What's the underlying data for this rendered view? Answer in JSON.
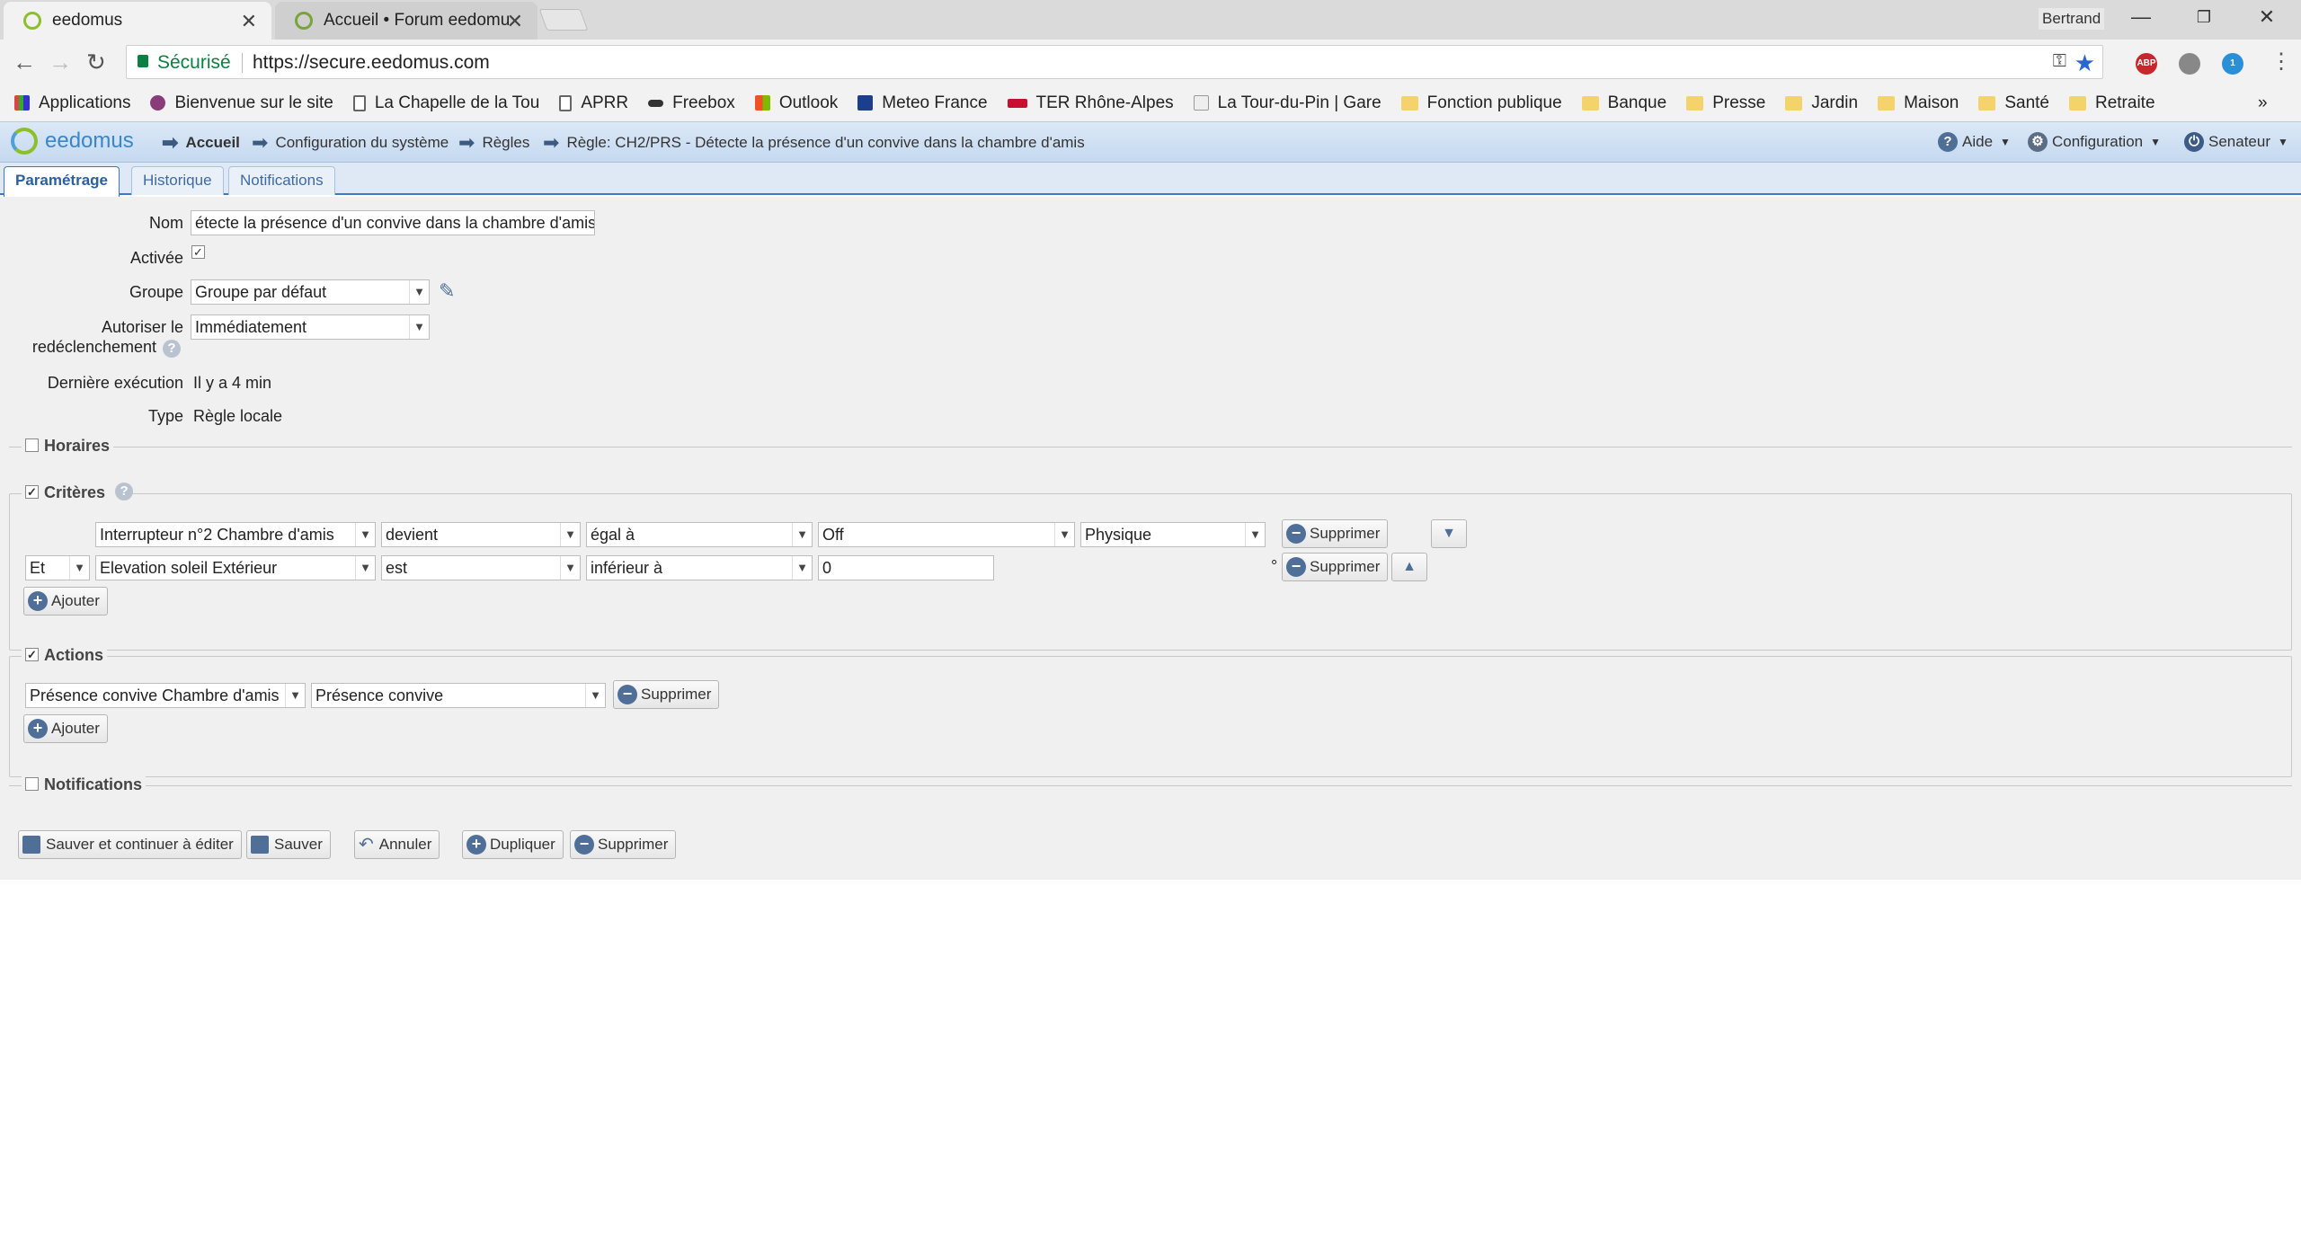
{
  "browser": {
    "tabs": [
      {
        "title": "eedomus"
      },
      {
        "title": "Accueil • Forum eedomu"
      }
    ],
    "profile": "Bertrand",
    "omnibox": {
      "secure_label": "Sécurisé",
      "url": "https://secure.eedomus.com"
    },
    "extensions": {
      "abp": "ABP",
      "badge": "1"
    },
    "bookmarks": [
      {
        "label": "Applications",
        "icon": "apps-grid-icon"
      },
      {
        "label": "Bienvenue sur le site",
        "icon": "site-icon"
      },
      {
        "label": "La Chapelle de la Tou",
        "icon": "page-icon"
      },
      {
        "label": "APRR",
        "icon": "page-icon"
      },
      {
        "label": "Freebox",
        "icon": "freebox-icon"
      },
      {
        "label": "Outlook",
        "icon": "windows-icon"
      },
      {
        "label": "Meteo France",
        "icon": "meteo-icon"
      },
      {
        "label": "TER Rhône-Alpes",
        "icon": "sncf-icon"
      },
      {
        "label": "La Tour-du-Pin | Gare",
        "icon": "train-icon"
      },
      {
        "label": "Fonction publique",
        "icon": "folder-icon"
      },
      {
        "label": "Banque",
        "icon": "folder-icon"
      },
      {
        "label": "Presse",
        "icon": "folder-icon"
      },
      {
        "label": "Jardin",
        "icon": "folder-icon"
      },
      {
        "label": "Maison",
        "icon": "folder-icon"
      },
      {
        "label": "Santé",
        "icon": "folder-icon"
      },
      {
        "label": "Retraite",
        "icon": "folder-icon"
      }
    ],
    "bookmarks_more": "»"
  },
  "app": {
    "logo": "eedomus",
    "breadcrumb": [
      "Accueil",
      "Configuration du système",
      "Règles",
      "Règle: CH2/PRS - Détecte la présence d'un convive dans la chambre d'amis"
    ],
    "menu": {
      "help": "Aide",
      "config": "Configuration",
      "user": "Senateur"
    },
    "tabs": [
      "Paramétrage",
      "Historique",
      "Notifications"
    ]
  },
  "form": {
    "nom_label": "Nom",
    "nom_value": "étecte la présence d'un convive dans la chambre d'amis",
    "activee_label": "Activée",
    "groupe_label": "Groupe",
    "groupe_value": "Groupe par défaut",
    "autoriser_label_1": "Autoriser le",
    "autoriser_label_2": "redéclenchement",
    "autoriser_value": "Immédiatement",
    "derniere_label": "Dernière exécution",
    "derniere_value": "Il y a 4 min",
    "type_label": "Type",
    "type_value": "Règle locale"
  },
  "sections": {
    "horaires": "Horaires",
    "criteres": "Critères",
    "actions": "Actions",
    "notifications": "Notifications"
  },
  "criteres": [
    {
      "connector": "",
      "device": "Interrupteur n°2 Chambre d'amis",
      "verb": "devient",
      "operator": "égal à",
      "value": "Off",
      "source": "Physique",
      "unit": "",
      "remove": "Supprimer"
    },
    {
      "connector": "Et",
      "device": "Elevation soleil Extérieur",
      "verb": "est",
      "operator": "inférieur à",
      "value": "0",
      "source": "",
      "unit": "°",
      "remove": "Supprimer"
    }
  ],
  "actions": [
    {
      "device": "Présence convive Chambre d'amis",
      "value": "Présence convive",
      "remove": "Supprimer"
    }
  ],
  "buttons": {
    "add": "Ajouter",
    "save_continue": "Sauver et continuer à éditer",
    "save": "Sauver",
    "cancel": "Annuler",
    "duplicate": "Dupliquer",
    "delete": "Supprimer"
  }
}
